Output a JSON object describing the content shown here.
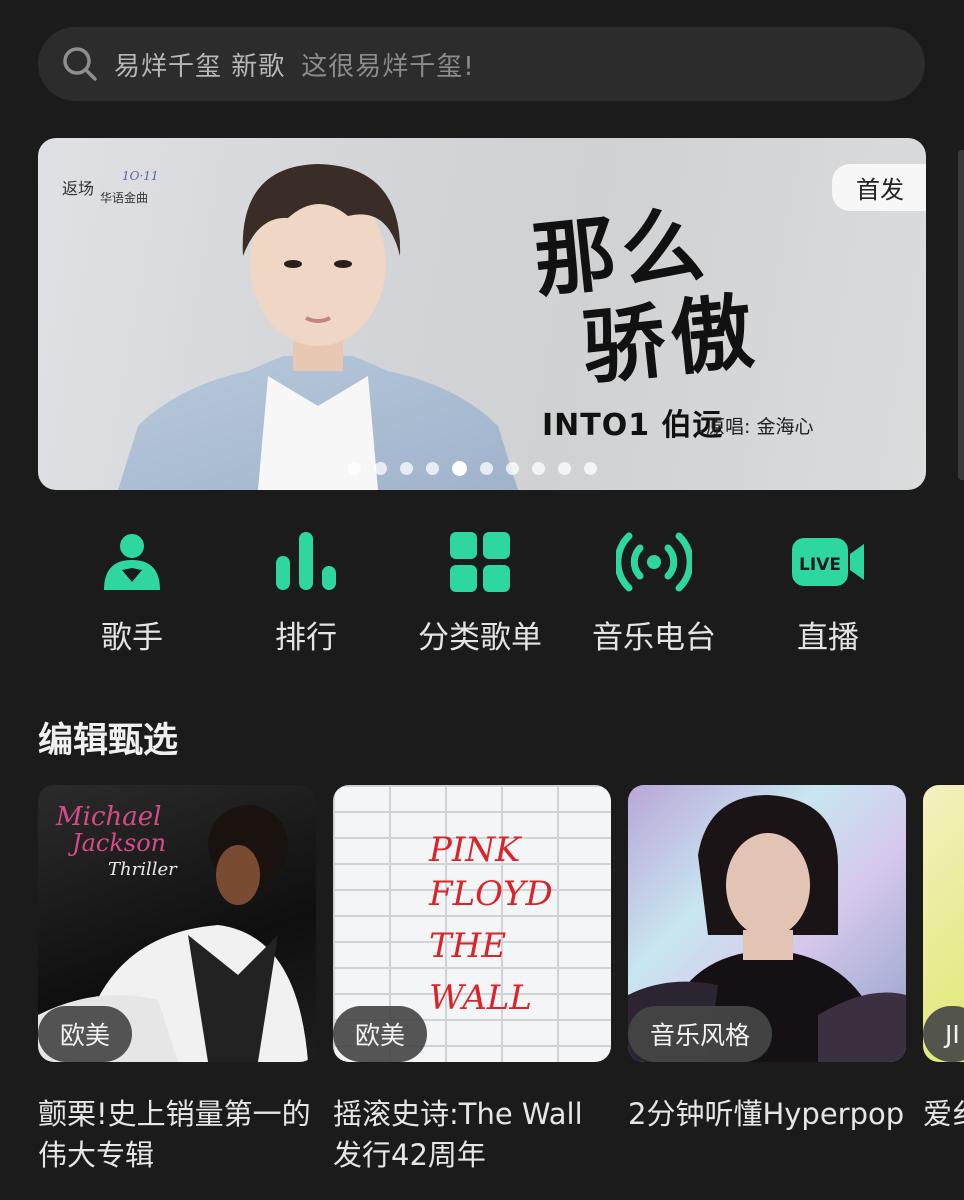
{
  "search": {
    "query": "易烊千玺 新歌",
    "suggestion": "这很易烊千玺!"
  },
  "banner": {
    "badge": "首发",
    "title_line1": "那么",
    "title_line2": "骄傲",
    "artist": "INTO1 伯远",
    "original_singer": "原唱: 金海心",
    "brand": "返场 华语金曲",
    "slide_count": 10,
    "active_slide": 5
  },
  "nav": {
    "items": [
      {
        "label": "歌手",
        "icon": "singer-icon"
      },
      {
        "label": "排行",
        "icon": "chart-icon"
      },
      {
        "label": "分类歌单",
        "icon": "category-icon"
      },
      {
        "label": "音乐电台",
        "icon": "radio-icon"
      },
      {
        "label": "直播",
        "icon": "live-icon"
      }
    ],
    "accent_color": "#2fd7a0"
  },
  "section": {
    "title": "编辑甄选",
    "cards": [
      {
        "badge": "欧美",
        "caption": "颤栗!史上销量第一的伟大专辑",
        "cover_text": "Michael Jackson Thriller"
      },
      {
        "badge": "欧美",
        "caption": "摇滚史诗:The Wall发行42周年",
        "cover_text": "PINK FLOYD THE WALL"
      },
      {
        "badge": "音乐风格",
        "caption": "2分钟听懂Hyperpop",
        "cover_text": ""
      },
      {
        "badge": "JI",
        "caption": "爱纟",
        "cover_text": ""
      }
    ]
  }
}
